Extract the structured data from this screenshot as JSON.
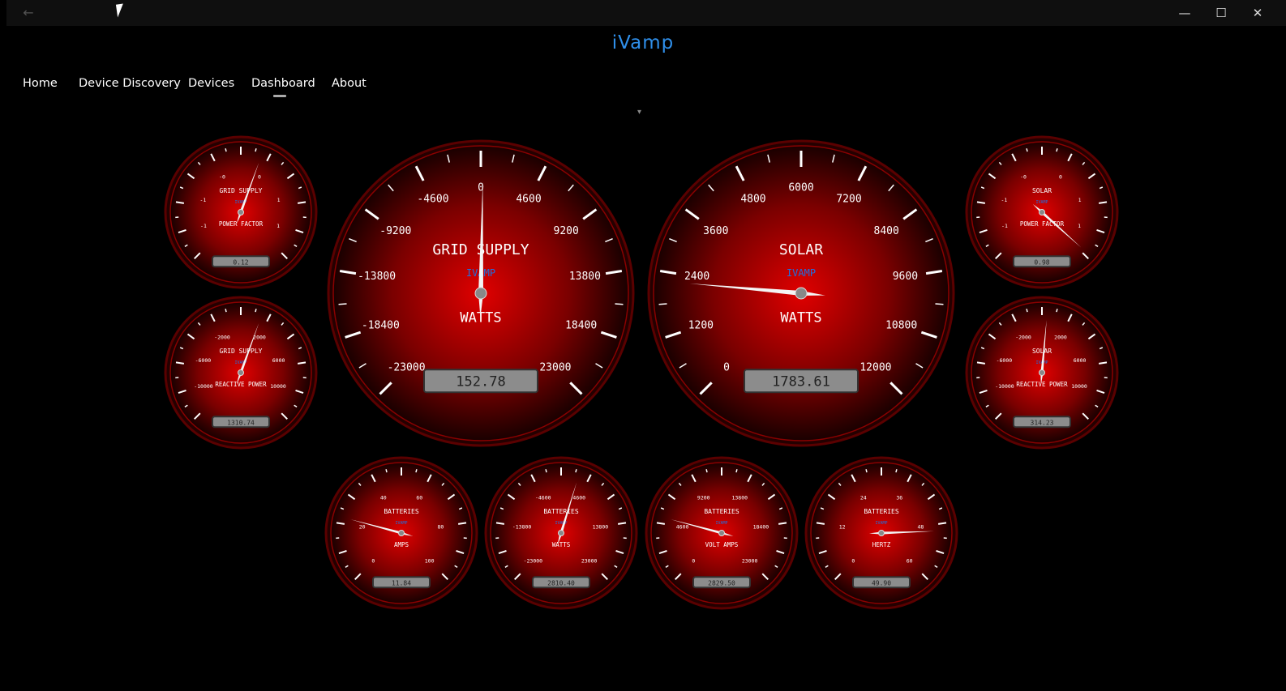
{
  "window": {
    "back_glyph": "←",
    "minimize_glyph": "—",
    "maximize_glyph": "☐",
    "close_glyph": "✕"
  },
  "app": {
    "title": "iVamp"
  },
  "nav": {
    "items": [
      {
        "label": "Home"
      },
      {
        "label": "Device Discovery"
      },
      {
        "label": "Devices"
      },
      {
        "label": "Dashboard"
      },
      {
        "label": "About"
      }
    ],
    "selected": "Dashboard",
    "expand_glyph": "▾"
  },
  "colors": {
    "accent": "#2f8fea",
    "gauge_red": "#e00000",
    "gauge_sub": "#1e6fe0"
  },
  "gauges": [
    {
      "id": "grid-pf",
      "title": "GRID SUPPLY",
      "brand": "IVAMP",
      "unit": "POWER FACTOR",
      "ticks": [
        "-1",
        "-0",
        "0",
        "1",
        "1",
        "-1"
      ],
      "tick_order": "left-high,left-top,top-right,right-high,right-low,left-low",
      "needle_deg": 20,
      "display": "0.12"
    },
    {
      "id": "grid-reactive",
      "title": "GRID SUPPLY",
      "brand": "IVAMP",
      "unit": "REACTIVE POWER",
      "ticks": [
        "-6000",
        "-2000",
        "2000",
        "6000",
        "10000",
        "-10000"
      ],
      "tick_order": "left-high,left-top,top-right,right-high,right-low,left-low",
      "needle_deg": 20,
      "display": "1310.74"
    },
    {
      "id": "grid-watts",
      "title": "GRID SUPPLY",
      "brand": "IVAMP",
      "unit": "WATTS",
      "ticks": [
        "-23000",
        "-18400",
        "-13800",
        "-9200",
        "-4600",
        "0",
        "4600",
        "9200",
        "13800",
        "18400",
        "23000"
      ],
      "needle_deg": 1,
      "display": "152.78"
    },
    {
      "id": "solar-watts",
      "title": "SOLAR",
      "brand": "IVAMP",
      "unit": "WATTS",
      "ticks": [
        "0",
        "1200",
        "2400",
        "3600",
        "4800",
        "6000",
        "7200",
        "8400",
        "9600",
        "10800",
        "12000"
      ],
      "needle_deg": -85,
      "display": "1783.61"
    },
    {
      "id": "solar-pf",
      "title": "SOLAR",
      "brand": "IVAMP",
      "unit": "POWER FACTOR",
      "ticks": [
        "-1",
        "-0",
        "0",
        "1",
        "1",
        "-1"
      ],
      "tick_order": "left-high,left-top,top-right,right-high,right-low,left-low",
      "needle_deg": 132,
      "display": "0.98"
    },
    {
      "id": "solar-reactive",
      "title": "SOLAR",
      "brand": "IVAMP",
      "unit": "REACTIVE POWER",
      "ticks": [
        "-6000",
        "-2000",
        "2000",
        "6000",
        "10000",
        "-10000"
      ],
      "tick_order": "left-high,left-top,top-right,right-high,right-low,left-low",
      "needle_deg": 5,
      "display": "314.23"
    },
    {
      "id": "batt-amps",
      "title": "BATTERIES",
      "brand": "IVAMP",
      "unit": "AMPS",
      "ticks": [
        "0",
        "20",
        "40",
        "60",
        "80",
        "100"
      ],
      "needle_deg": -75,
      "display": "11.84"
    },
    {
      "id": "batt-watts",
      "title": "BATTERIES",
      "brand": "IVAMP",
      "unit": "WATTS",
      "ticks": [
        "-23000",
        "-13800",
        "-4600",
        "4600",
        "13800",
        "23000"
      ],
      "needle_deg": 17,
      "display": "2810.40"
    },
    {
      "id": "batt-va",
      "title": "BATTERIES",
      "brand": "IVAMP",
      "unit": "VOLT AMPS",
      "ticks": [
        "0",
        "4600",
        "9200",
        "13800",
        "18400",
        "23000"
      ],
      "needle_deg": -75,
      "display": "2829.50"
    },
    {
      "id": "batt-hz",
      "title": "BATTERIES",
      "brand": "IVAMP",
      "unit": "HERTZ",
      "ticks": [
        "0",
        "12",
        "24",
        "36",
        "48",
        "60"
      ],
      "needle_deg": 88,
      "display": "49.90"
    }
  ]
}
